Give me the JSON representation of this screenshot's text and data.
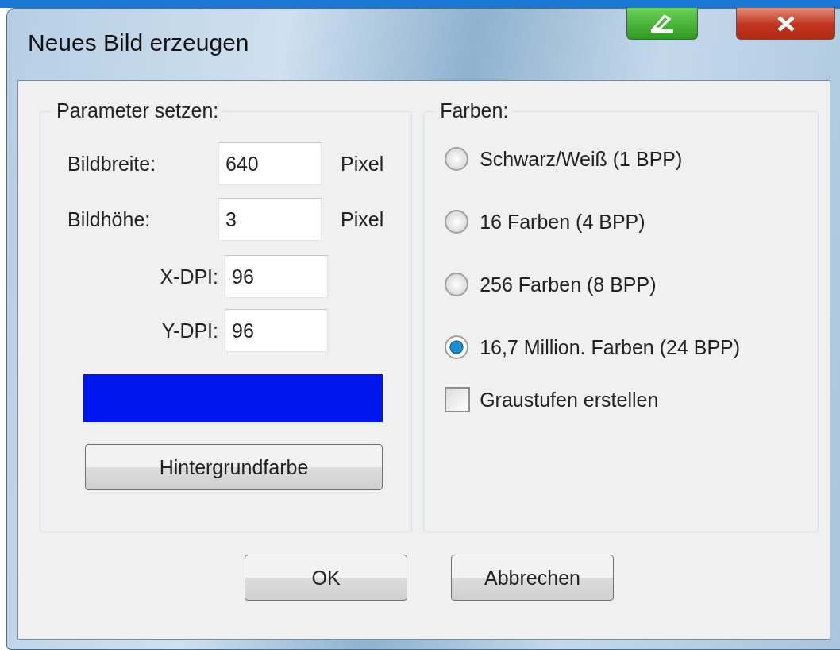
{
  "window": {
    "title": "Neues Bild erzeugen"
  },
  "parameters": {
    "title": "Parameter setzen:",
    "size_fields": [
      {
        "label": "Bildbreite:",
        "value": "640",
        "unit": "Pixel"
      },
      {
        "label": "Bildhöhe:",
        "value": "3",
        "unit": "Pixel"
      }
    ],
    "dpi_fields": [
      {
        "label": "X-DPI:",
        "value": "96"
      },
      {
        "label": "Y-DPI:",
        "value": "96"
      }
    ],
    "preview": {
      "color": "#0016ee"
    },
    "background_button": "Hintergrundfarbe"
  },
  "colors": {
    "title": "Farben:",
    "options": [
      {
        "label": "Schwarz/Weiß (1 BPP)",
        "selected": false
      },
      {
        "label": "16 Farben (4 BPP)",
        "selected": false
      },
      {
        "label": "256 Farben (8 BPP)",
        "selected": false
      },
      {
        "label": "16,7 Million. Farben (24 BPP)",
        "selected": true
      }
    ],
    "grayscale": {
      "label": "Graustufen erstellen",
      "checked": false
    }
  },
  "buttons": [
    "OK",
    "Abbrechen"
  ]
}
